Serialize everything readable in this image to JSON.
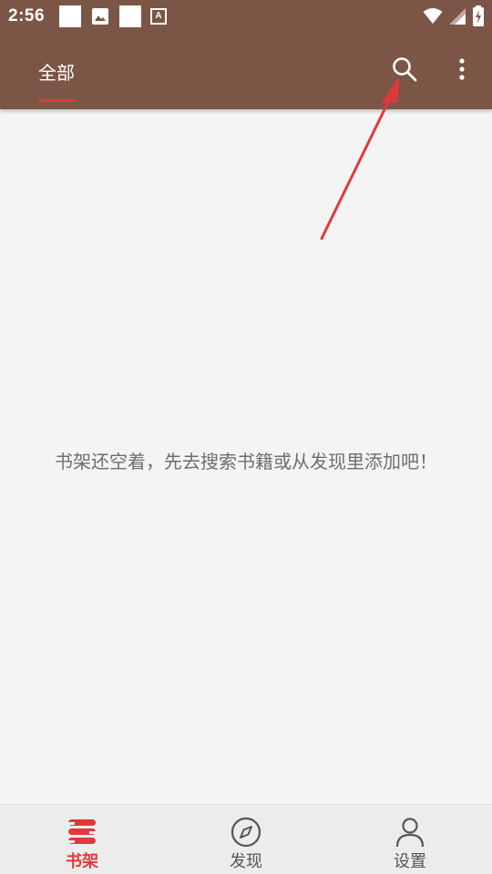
{
  "status_bar": {
    "time": "2:56",
    "font_badge": "A",
    "icons": [
      "notification-square-icon",
      "image-icon",
      "notification-square-icon",
      "font-icon",
      "wifi-icon",
      "cellular-signal-icon",
      "battery-charging-icon"
    ]
  },
  "app_bar": {
    "tabs": [
      {
        "label": "全部",
        "active": true
      }
    ],
    "actions": [
      "search-icon",
      "more-vert-icon"
    ],
    "background": "#7b5546",
    "indicator_color": "#e0393b"
  },
  "main": {
    "empty_message": "书架还空着，先去搜索书籍或从发现里添加吧！"
  },
  "annotation": {
    "arrow_color": "#e0393b",
    "points_to": "search-icon"
  },
  "bottom_nav": {
    "items": [
      {
        "label": "书架",
        "icon": "bookshelf-icon",
        "active": true
      },
      {
        "label": "发现",
        "icon": "compass-icon",
        "active": false
      },
      {
        "label": "设置",
        "icon": "person-icon",
        "active": false
      }
    ],
    "active_color": "#e0393b"
  }
}
